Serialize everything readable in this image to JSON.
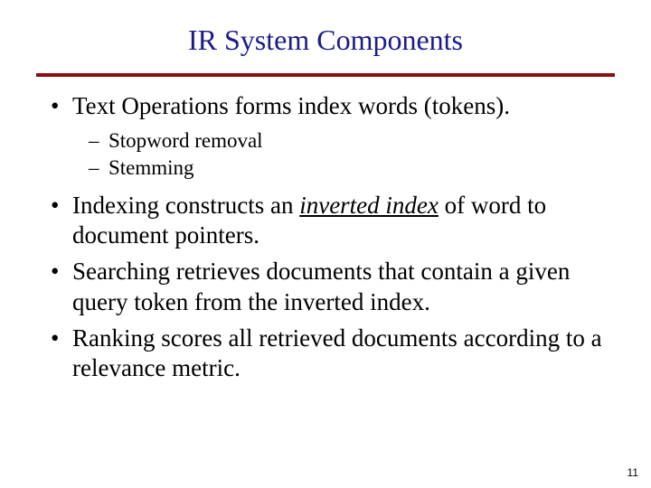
{
  "title": "IR System Components",
  "bullets": {
    "b1_lead": "Text Operations",
    "b1_rest": " forms index words (tokens).",
    "s1": "Stopword removal",
    "s2": "Stemming",
    "b2_lead": "Indexing",
    "b2_mid": " constructs an ",
    "b2_emph": "inverted index",
    "b2_rest": " of word to document pointers.",
    "b3_lead": "Searching",
    "b3_rest": " retrieves documents that contain a given query token from the inverted index.",
    "b4_lead": "Ranking",
    "b4_rest": " scores all retrieved documents according to a relevance metric."
  },
  "page_number": "11"
}
